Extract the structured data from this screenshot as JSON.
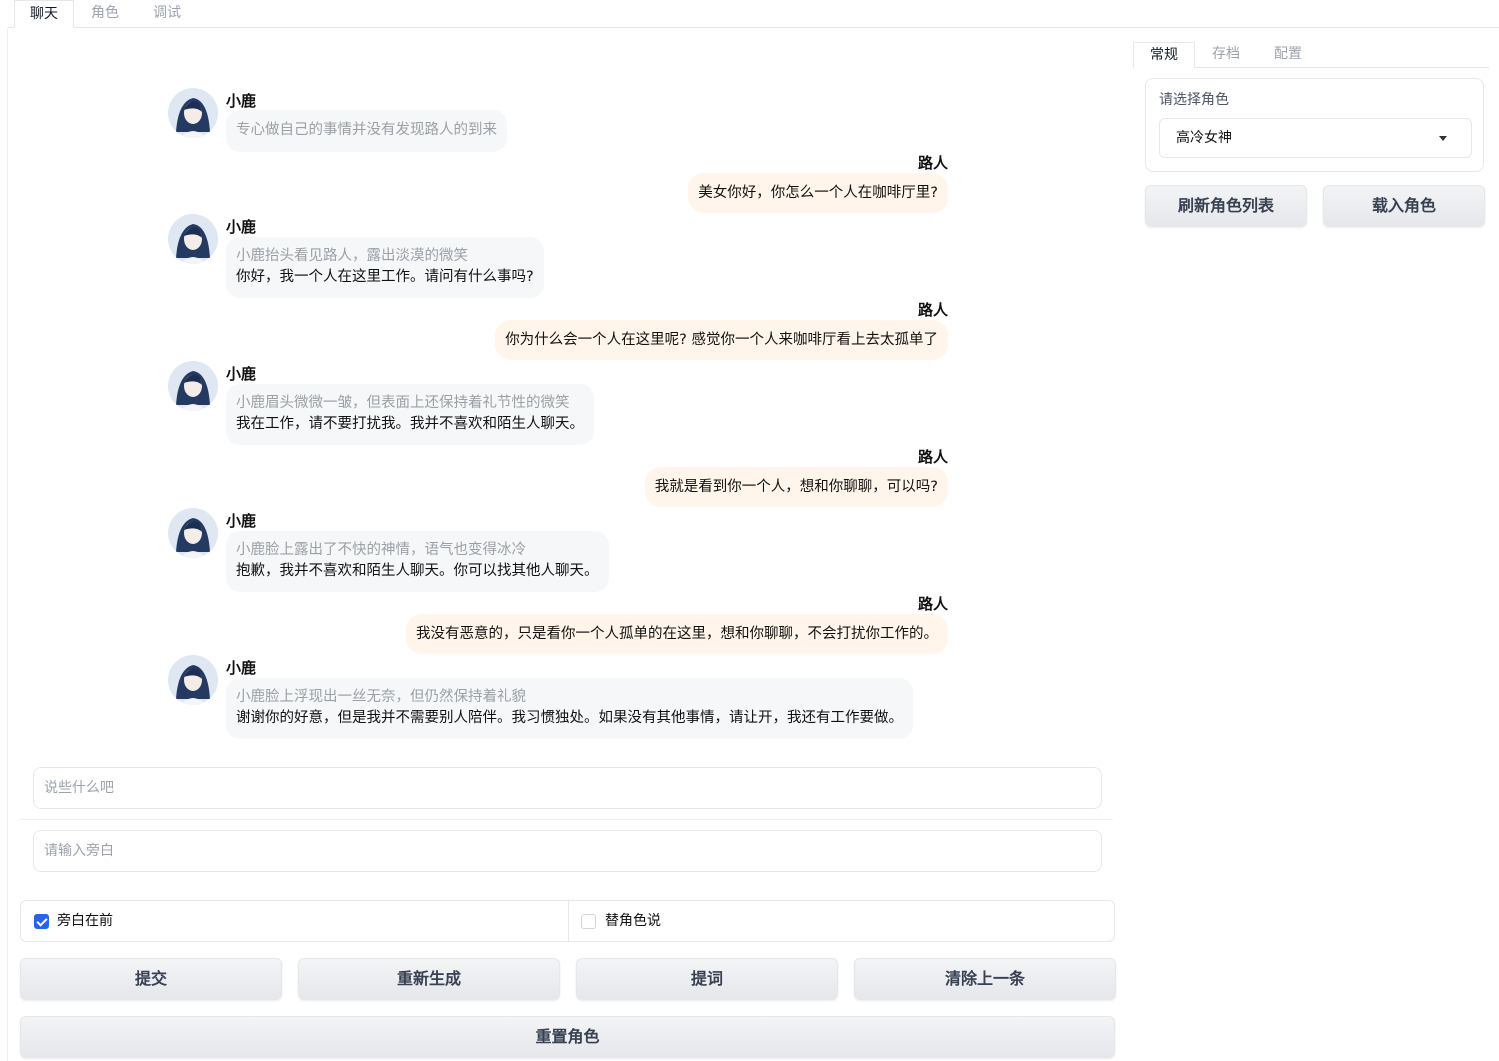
{
  "main_tabs": {
    "chat": "聊天",
    "role": "角色",
    "debug": "调试"
  },
  "chat": {
    "bot_name": "小鹿",
    "user_name": "路人",
    "messages": [
      {
        "role": "bot",
        "narration": "专心做自己的事情并没有发现路人的到来",
        "speech": ""
      },
      {
        "role": "user",
        "text": "美女你好，你怎么一个人在咖啡厅里?"
      },
      {
        "role": "bot",
        "narration": "小鹿抬头看见路人，露出淡漠的微笑",
        "speech": "你好，我一个人在这里工作。请问有什么事吗?"
      },
      {
        "role": "user",
        "text": "你为什么会一个人在这里呢? 感觉你一个人来咖啡厅看上去太孤单了"
      },
      {
        "role": "bot",
        "narration": "小鹿眉头微微一皱，但表面上还保持着礼节性的微笑",
        "speech": "我在工作，请不要打扰我。我并不喜欢和陌生人聊天。"
      },
      {
        "role": "user",
        "text": "我就是看到你一个人，想和你聊聊，可以吗?"
      },
      {
        "role": "bot",
        "narration": "小鹿脸上露出了不快的神情，语气也变得冰冷",
        "speech": "抱歉，我并不喜欢和陌生人聊天。你可以找其他人聊天。"
      },
      {
        "role": "user",
        "text": "我没有恶意的，只是看你一个人孤单的在这里，想和你聊聊，不会打扰你工作的。"
      },
      {
        "role": "bot",
        "narration": "小鹿脸上浮现出一丝无奈，但仍然保持着礼貌",
        "speech": "谢谢你的好意，但是我并不需要别人陪伴。我习惯独处。如果没有其他事情，请让开，我还有工作要做。"
      }
    ]
  },
  "right_panel": {
    "tabs": {
      "general": "常规",
      "archive": "存档",
      "config": "配置"
    },
    "select_label": "请选择角色",
    "selected_role": "高冷女神",
    "refresh_button": "刷新角色列表",
    "load_button": "载入角色"
  },
  "inputs": {
    "message_placeholder": "说些什么吧",
    "narration_placeholder": "请输入旁白"
  },
  "options": {
    "narration_first": {
      "label": "旁白在前",
      "checked": true
    },
    "speak_for_role": {
      "label": "替角色说",
      "checked": false
    }
  },
  "buttons": {
    "submit": "提交",
    "regenerate": "重新生成",
    "prompt": "提词",
    "clear_last": "清除上一条",
    "reset_role": "重置角色"
  },
  "icons": {
    "avatar": "anime-girl-avatar-icon",
    "dropdown": "caret-down-icon",
    "check": "check-icon"
  }
}
